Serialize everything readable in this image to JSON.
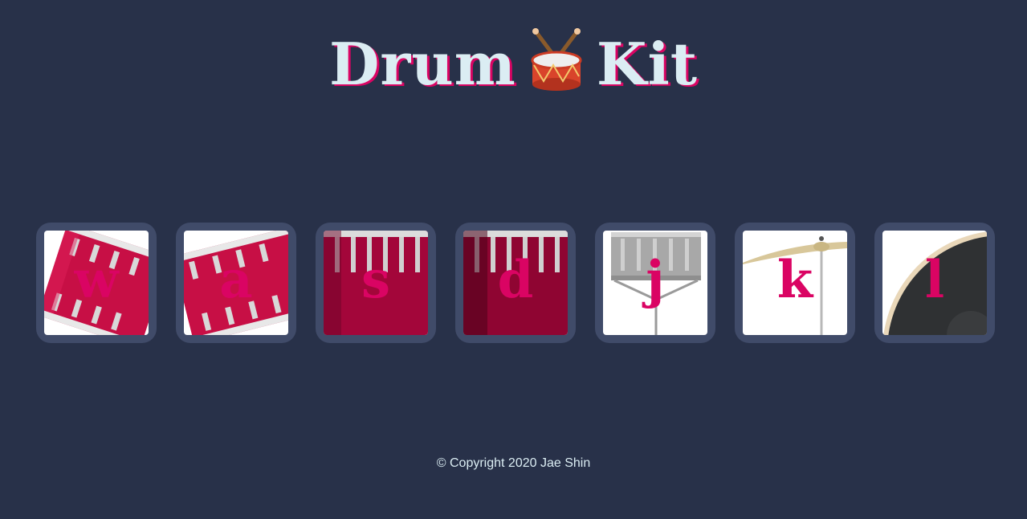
{
  "header": {
    "title_left": "Drum",
    "title_right": "Kit",
    "title_emoji": "drum-icon"
  },
  "drums": [
    {
      "key": "w",
      "image": "tom-red-tilted",
      "color": "#c70f45"
    },
    {
      "key": "a",
      "image": "tom-red-tilted",
      "color": "#c70f45"
    },
    {
      "key": "s",
      "image": "snare-red",
      "color": "#a3063a"
    },
    {
      "key": "d",
      "image": "snare-red-dark",
      "color": "#8f0532"
    },
    {
      "key": "j",
      "image": "snare-silver-on-stand",
      "color": "#a8a8a8"
    },
    {
      "key": "k",
      "image": "crash-cymbal",
      "color": "#d8c79a"
    },
    {
      "key": "l",
      "image": "kick-drum",
      "color": "#2f3133"
    }
  ],
  "footer": {
    "copyright": "© Copyright 2020 Jae Shin"
  },
  "colors": {
    "background": "#283149",
    "pad_frame": "#404B69",
    "title_text": "#DBEDF3",
    "accent": "#DA0463"
  }
}
